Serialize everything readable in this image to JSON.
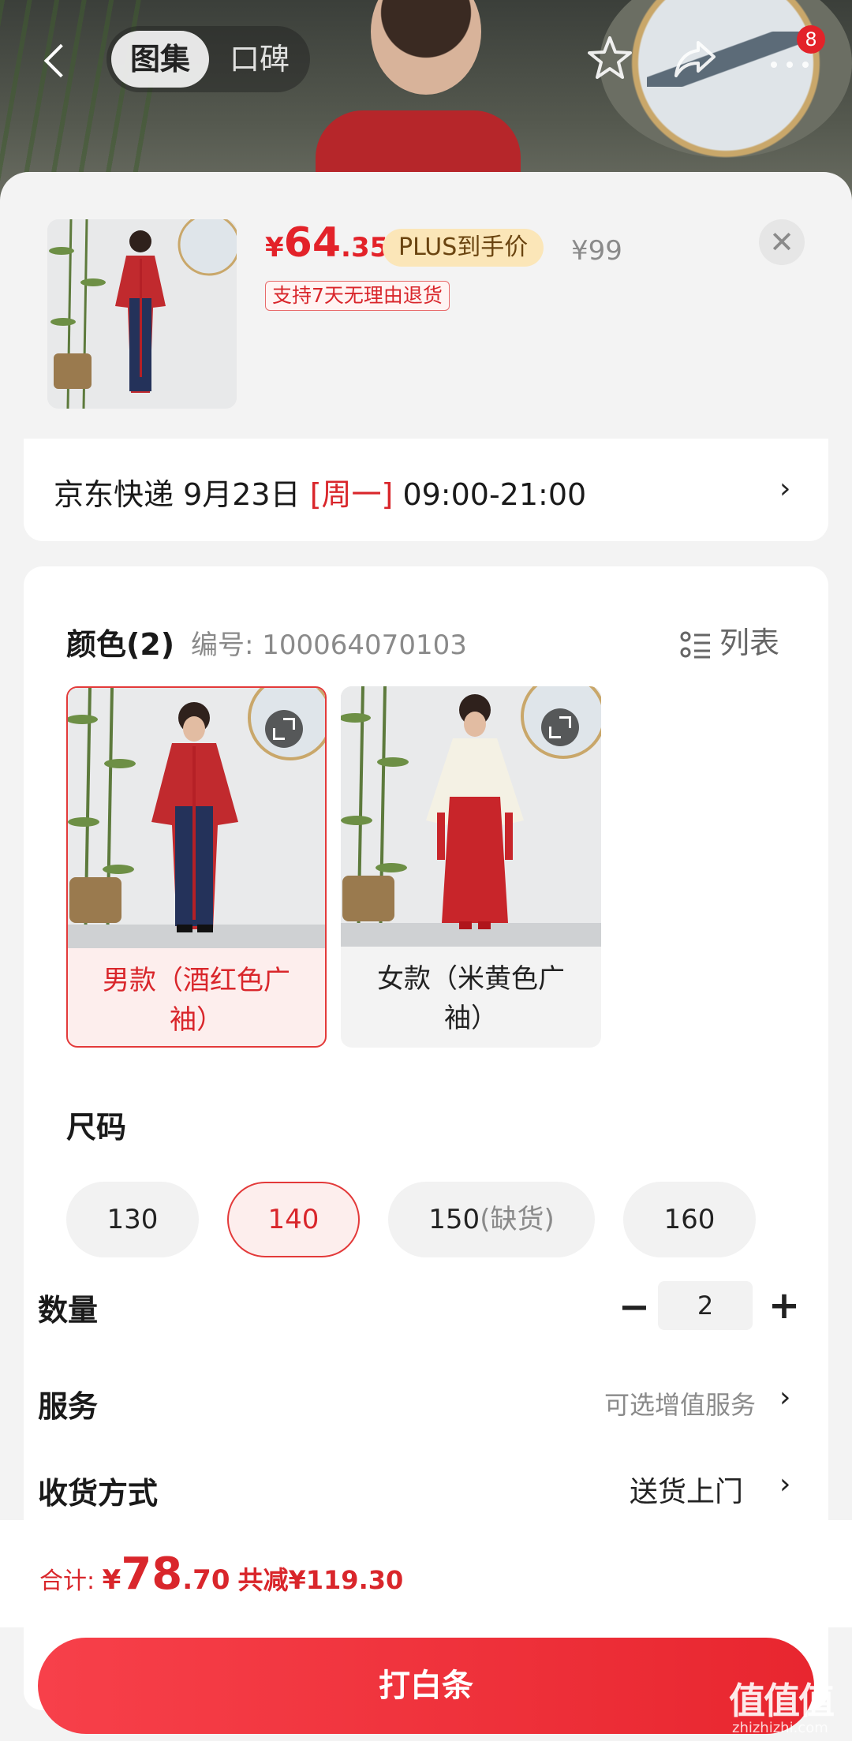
{
  "header": {
    "tabs": [
      {
        "label": "图集",
        "active": true
      },
      {
        "label": "口碑",
        "active": false
      }
    ],
    "icons": [
      "back-icon",
      "star-icon",
      "share-icon",
      "more-icon"
    ],
    "message_badge": "8"
  },
  "product": {
    "price_currency": "¥",
    "price_int": "64",
    "price_dec": ".35",
    "plus_tag": "PLUS到手价",
    "original_price": "¥99",
    "return_policy": "支持7天无理由退货"
  },
  "delivery": {
    "prefix": "京东快递 9月23日 ",
    "weekday": "[周一]",
    "time": " 09:00-21:00"
  },
  "color_section": {
    "title": "颜色(2)",
    "sku_label": "编号: 100064070103",
    "list_toggle": "列表",
    "options": [
      {
        "label": "男款（酒红色广袖）",
        "selected": true
      },
      {
        "label": "女款（米黄色广袖）",
        "selected": false
      }
    ]
  },
  "size_section": {
    "title": "尺码",
    "options": [
      {
        "value": "130",
        "note": "",
        "selected": false
      },
      {
        "value": "140",
        "note": "",
        "selected": true
      },
      {
        "value": "150",
        "note": "(缺货)",
        "selected": false
      },
      {
        "value": "160",
        "note": "",
        "selected": false
      }
    ]
  },
  "quantity": {
    "label": "数量",
    "value": "2",
    "minus": "−",
    "plus": "+"
  },
  "service": {
    "label": "服务",
    "value": "可选增值服务"
  },
  "shipping": {
    "label": "收货方式",
    "value": "送货上门"
  },
  "total": {
    "label": "合计: ",
    "currency": "¥",
    "int": "78",
    "dec": ".70",
    "discount": "共减¥119.30"
  },
  "pay_button": "打白条",
  "watermark": {
    "main": "值值值",
    "sub": "zhizhizhi.com"
  },
  "colors": {
    "accent_red": "#e32229",
    "plus_gold": "#fbe6b8",
    "sheet_bg": "#f3f3f3"
  }
}
